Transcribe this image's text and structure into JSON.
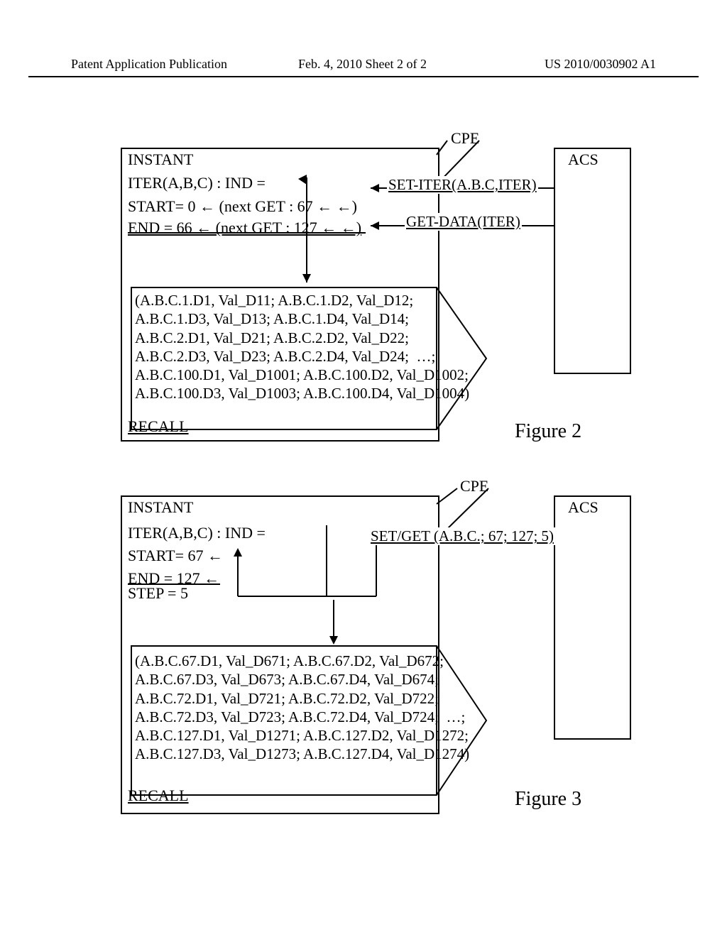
{
  "header": {
    "left": "Patent Application Publication",
    "mid": "Feb. 4, 2010   Sheet 2 of 2",
    "right": "US 2010/0030902 A1"
  },
  "fig2": {
    "cpe_label": "CPE",
    "acs_label": "ACS",
    "instant": "INSTANT",
    "iter_line": "ITER(A,B,C) : IND  =",
    "start_line": "START= 0   ←   (next GET : 67   ←   ←)",
    "end_line": "END = 66   ←   (next GET : 127  ←   ←)",
    "msg_set": "SET-ITER(A.B.C,ITER)",
    "msg_get": "GET-DATA(ITER)",
    "data": "(A.B.C.1.D1, Val_D11; A.B.C.1.D2, Val_D12;\nA.B.C.1.D3, Val_D13; A.B.C.1.D4, Val_D14;\nA.B.C.2.D1, Val_D21; A.B.C.2.D2, Val_D22;\nA.B.C.2.D3, Val_D23; A.B.C.2.D4, Val_D24;  …;\nA.B.C.100.D1, Val_D1001; A.B.C.100.D2, Val_D1002;\nA.B.C.100.D3, Val_D1003; A.B.C.100.D4, Val_D1004)",
    "recall": "RECALL",
    "caption": "Figure 2"
  },
  "fig3": {
    "cpe_label": "CPE",
    "acs_label": "ACS",
    "instant": "INSTANT",
    "iter_line": "ITER(A,B,C) : IND  =",
    "start_line": "START= 67  ←",
    "end_line": "END = 127  ←",
    "step_line": "STEP = 5",
    "msg_setget": "SET/GET (A.B.C.; 67; 127; 5)",
    "data": "(A.B.C.67.D1, Val_D671; A.B.C.67.D2, Val_D672;\nA.B.C.67.D3, Val_D673; A.B.C.67.D4, Val_D674;\nA.B.C.72.D1, Val_D721; A.B.C.72.D2, Val_D722;\nA.B.C.72.D3, Val_D723; A.B.C.72.D4, Val_D724;  …;\nA.B.C.127.D1, Val_D1271; A.B.C.127.D2, Val_D1272;\nA.B.C.127.D3, Val_D1273; A.B.C.127.D4, Val_D1274)",
    "recall": "RECALL",
    "caption": "Figure 3"
  }
}
